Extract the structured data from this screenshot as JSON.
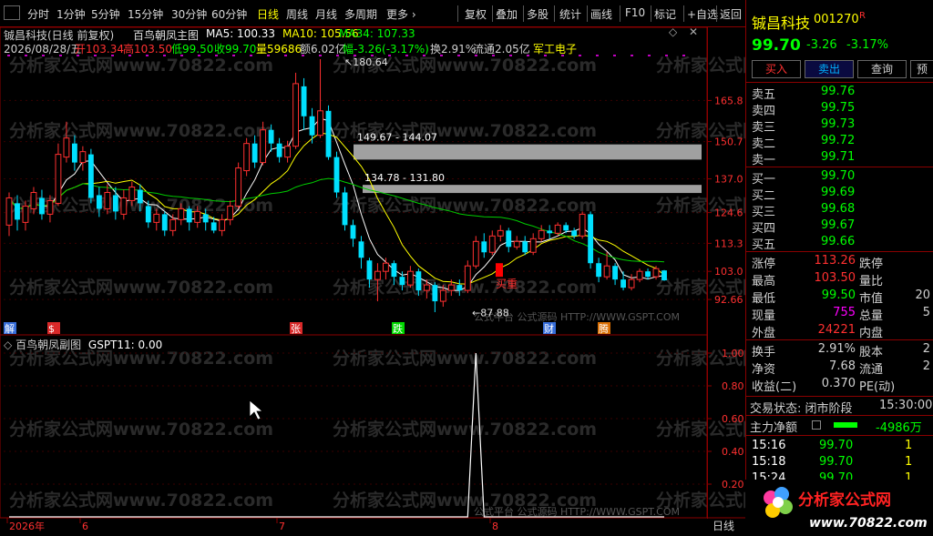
{
  "toolbar": {
    "left_items": [
      "分时",
      "1分钟",
      "5分钟",
      "15分钟",
      "30分钟",
      "60分钟",
      "日线",
      "周线",
      "月线",
      "多周期",
      "更多 ›"
    ],
    "right_items": [
      "复权",
      "叠加",
      "多股",
      "统计",
      "画线",
      "F10",
      "标记",
      "+自选",
      "返回"
    ],
    "active": "日线"
  },
  "header": {
    "line1_name": "铖昌科技(日线 前复权)",
    "line1_indicator": "百鸟朝凤主图",
    "ma5": "MA5: 100.33",
    "ma10": "MA10: 105.56",
    "ma34": "MA34: 107.33",
    "date": "2026/08/28/五",
    "open": "开103.34",
    "high": "高103.50",
    "low": "低99.50",
    "close": "收99.70",
    "volume": "量59686",
    "amount": "额6.02亿",
    "change": "幅-3.26(-3.17%)",
    "turnover": "换2.91%",
    "float": "流通2.05亿",
    "sector": "军工电子"
  },
  "main_chart": {
    "type": "candlestick",
    "y_ticks": [
      "165.8",
      "150.7",
      "137.0",
      "124.6",
      "113.3",
      "103.0",
      "92.66"
    ],
    "annotations": [
      "180.64",
      "149.67 - 144.07",
      "134.78 - 131.80",
      "87.88",
      "买重"
    ],
    "markers": [
      "解",
      "$",
      "张",
      "跌",
      "财",
      "腾"
    ],
    "candles": [
      {
        "o": 120,
        "c": 130,
        "h": 132,
        "l": 116
      },
      {
        "o": 128,
        "c": 122,
        "h": 131,
        "l": 118
      },
      {
        "o": 121,
        "c": 127,
        "h": 129,
        "l": 118
      },
      {
        "o": 126,
        "c": 132,
        "h": 134,
        "l": 124
      },
      {
        "o": 130,
        "c": 124,
        "h": 133,
        "l": 122
      },
      {
        "o": 124,
        "c": 129,
        "h": 131,
        "l": 121
      },
      {
        "o": 128,
        "c": 146,
        "h": 150,
        "l": 127
      },
      {
        "o": 145,
        "c": 152,
        "h": 158,
        "l": 143
      },
      {
        "o": 150,
        "c": 143,
        "h": 153,
        "l": 140
      },
      {
        "o": 143,
        "c": 147,
        "h": 149,
        "l": 140
      },
      {
        "o": 146,
        "c": 130,
        "h": 148,
        "l": 128
      },
      {
        "o": 131,
        "c": 126,
        "h": 134,
        "l": 123
      },
      {
        "o": 126,
        "c": 132,
        "h": 135,
        "l": 124
      },
      {
        "o": 131,
        "c": 125,
        "h": 134,
        "l": 122
      },
      {
        "o": 124,
        "c": 130,
        "h": 133,
        "l": 122
      },
      {
        "o": 129,
        "c": 134,
        "h": 136,
        "l": 127
      },
      {
        "o": 133,
        "c": 128,
        "h": 135,
        "l": 125
      },
      {
        "o": 127,
        "c": 121,
        "h": 129,
        "l": 119
      },
      {
        "o": 121,
        "c": 124,
        "h": 126,
        "l": 118
      },
      {
        "o": 124,
        "c": 118,
        "h": 125,
        "l": 116
      },
      {
        "o": 118,
        "c": 122,
        "h": 124,
        "l": 116
      },
      {
        "o": 122,
        "c": 126,
        "h": 128,
        "l": 120
      },
      {
        "o": 126,
        "c": 121,
        "h": 127,
        "l": 118
      },
      {
        "o": 121,
        "c": 125,
        "h": 127,
        "l": 119
      },
      {
        "o": 124,
        "c": 121,
        "h": 126,
        "l": 118
      },
      {
        "o": 121,
        "c": 118,
        "h": 123,
        "l": 117
      },
      {
        "o": 118,
        "c": 122,
        "h": 124,
        "l": 116
      },
      {
        "o": 122,
        "c": 127,
        "h": 129,
        "l": 120
      },
      {
        "o": 127,
        "c": 141,
        "h": 143,
        "l": 126
      },
      {
        "o": 140,
        "c": 150,
        "h": 152,
        "l": 138
      },
      {
        "o": 150,
        "c": 143,
        "h": 153,
        "l": 141
      },
      {
        "o": 143,
        "c": 155,
        "h": 158,
        "l": 142
      },
      {
        "o": 155,
        "c": 150,
        "h": 157,
        "l": 147
      },
      {
        "o": 150,
        "c": 145,
        "h": 152,
        "l": 143
      },
      {
        "o": 145,
        "c": 149,
        "h": 151,
        "l": 143
      },
      {
        "o": 149,
        "c": 172,
        "h": 176,
        "l": 148
      },
      {
        "o": 171,
        "c": 160,
        "h": 174,
        "l": 155
      },
      {
        "o": 160,
        "c": 153,
        "h": 163,
        "l": 150
      },
      {
        "o": 153,
        "c": 162,
        "h": 181,
        "l": 152
      },
      {
        "o": 162,
        "c": 145,
        "h": 164,
        "l": 144
      },
      {
        "o": 145,
        "c": 132,
        "h": 147,
        "l": 130
      },
      {
        "o": 132,
        "c": 120,
        "h": 134,
        "l": 118
      },
      {
        "o": 120,
        "c": 115,
        "h": 122,
        "l": 112
      },
      {
        "o": 114,
        "c": 108,
        "h": 116,
        "l": 104
      },
      {
        "o": 107,
        "c": 100,
        "h": 108,
        "l": 97
      },
      {
        "o": 100,
        "c": 103,
        "h": 106,
        "l": 92
      },
      {
        "o": 103,
        "c": 106,
        "h": 108,
        "l": 100
      },
      {
        "o": 106,
        "c": 101,
        "h": 107,
        "l": 98
      },
      {
        "o": 101,
        "c": 98,
        "h": 103,
        "l": 96
      },
      {
        "o": 98,
        "c": 103,
        "h": 105,
        "l": 97
      },
      {
        "o": 103,
        "c": 96,
        "h": 104,
        "l": 94
      },
      {
        "o": 96,
        "c": 98,
        "h": 100,
        "l": 93
      },
      {
        "o": 98,
        "c": 92,
        "h": 99,
        "l": 88
      },
      {
        "o": 92,
        "c": 96,
        "h": 98,
        "l": 90
      },
      {
        "o": 96,
        "c": 98,
        "h": 100,
        "l": 94
      },
      {
        "o": 98,
        "c": 96,
        "h": 100,
        "l": 94
      },
      {
        "o": 96,
        "c": 105,
        "h": 107,
        "l": 95
      },
      {
        "o": 105,
        "c": 114,
        "h": 116,
        "l": 104
      },
      {
        "o": 114,
        "c": 110,
        "h": 117,
        "l": 108
      },
      {
        "o": 110,
        "c": 116,
        "h": 118,
        "l": 109
      },
      {
        "o": 116,
        "c": 118,
        "h": 120,
        "l": 114
      },
      {
        "o": 118,
        "c": 112,
        "h": 119,
        "l": 110
      },
      {
        "o": 112,
        "c": 114,
        "h": 116,
        "l": 111
      },
      {
        "o": 114,
        "c": 110,
        "h": 116,
        "l": 109
      },
      {
        "o": 110,
        "c": 115,
        "h": 117,
        "l": 109
      },
      {
        "o": 115,
        "c": 118,
        "h": 120,
        "l": 114
      },
      {
        "o": 118,
        "c": 117,
        "h": 120,
        "l": 115
      },
      {
        "o": 117,
        "c": 120,
        "h": 121,
        "l": 116
      },
      {
        "o": 120,
        "c": 118,
        "h": 121,
        "l": 117
      },
      {
        "o": 118,
        "c": 116,
        "h": 119,
        "l": 115
      },
      {
        "o": 116,
        "c": 124,
        "h": 125,
        "l": 115
      },
      {
        "o": 124,
        "c": 106,
        "h": 125,
        "l": 104
      },
      {
        "o": 106,
        "c": 101,
        "h": 108,
        "l": 99
      },
      {
        "o": 101,
        "c": 105,
        "h": 110,
        "l": 100
      },
      {
        "o": 105,
        "c": 100,
        "h": 106,
        "l": 98
      },
      {
        "o": 100,
        "c": 97,
        "h": 103,
        "l": 96
      },
      {
        "o": 97,
        "c": 100,
        "h": 102,
        "l": 96
      },
      {
        "o": 100,
        "c": 103,
        "h": 104,
        "l": 99
      },
      {
        "o": 103,
        "c": 101,
        "h": 104,
        "l": 100
      },
      {
        "o": 101,
        "c": 104,
        "h": 105,
        "l": 100
      },
      {
        "o": 103.34,
        "c": 99.7,
        "h": 103.5,
        "l": 99.5
      }
    ]
  },
  "sub_chart": {
    "title": "百鸟朝凤副图",
    "indicator": "GSPT11: 0.00",
    "y_ticks": [
      "1.00",
      "0.80",
      "0.60",
      "0.40",
      "0.20"
    ],
    "x_ticks": [
      "2026年",
      "6",
      "7",
      "8"
    ],
    "period_label": "日线",
    "spike_index": 57
  },
  "watermark": "分析家公式网www.70822.com",
  "right_panel": {
    "stock_name": "铖昌科技",
    "stock_code": "001270",
    "stock_flag": "R",
    "price": "99.70",
    "change": "-3.26",
    "change_pct": "-3.17%",
    "buttons": [
      "买入",
      "卖出",
      "查询",
      "预"
    ],
    "sell": [
      {
        "label": "卖五",
        "price": "99.76"
      },
      {
        "label": "卖四",
        "price": "99.75"
      },
      {
        "label": "卖三",
        "price": "99.73"
      },
      {
        "label": "卖二",
        "price": "99.72"
      },
      {
        "label": "卖一",
        "price": "99.71"
      }
    ],
    "buy": [
      {
        "label": "买一",
        "price": "99.70"
      },
      {
        "label": "买二",
        "price": "99.69"
      },
      {
        "label": "买三",
        "price": "99.68"
      },
      {
        "label": "买四",
        "price": "99.67"
      },
      {
        "label": "买五",
        "price": "99.66"
      }
    ],
    "stats": [
      {
        "l1": "涨停",
        "v1": "113.26",
        "l2": "跌停",
        "c": "#ff3030"
      },
      {
        "l1": "最高",
        "v1": "103.50",
        "l2": "量比",
        "c": "#ff3030"
      },
      {
        "l1": "最低",
        "v1": "99.50",
        "l2": "市值",
        "v2": "20",
        "c": "#00ff00"
      },
      {
        "l1": "现量",
        "v1": "755",
        "l2": "总量",
        "v2": "5",
        "c": "#ff00ff"
      },
      {
        "l1": "外盘",
        "v1": "24221",
        "l2": "内盘",
        "c": "#ff3030"
      }
    ],
    "stats2": [
      {
        "l1": "换手",
        "v1": "2.91%",
        "l2": "股本",
        "v2": "2"
      },
      {
        "l1": "净资",
        "v1": "7.68",
        "l2": "流通",
        "v2": "2"
      },
      {
        "l1": "收益(二)",
        "v1": "0.370",
        "l2": "PE(动)",
        "v2": ""
      }
    ],
    "status_label": "交易状态: 闭市阶段",
    "status_time": "15:30:00",
    "main_flow_label": "主力净额",
    "main_flow_value": "-4986万",
    "ticks": [
      {
        "t": "15:16",
        "p": "99.70",
        "v": "1"
      },
      {
        "t": "15:18",
        "p": "99.70",
        "v": "1"
      },
      {
        "t": "15:24",
        "p": "99.70",
        "v": "1"
      }
    ]
  },
  "logo": {
    "title": "分析家公式网",
    "url": "www.70822.com"
  },
  "source_note": "公式平台 公式源码 HTTP://WWW.GSPT.COM"
}
